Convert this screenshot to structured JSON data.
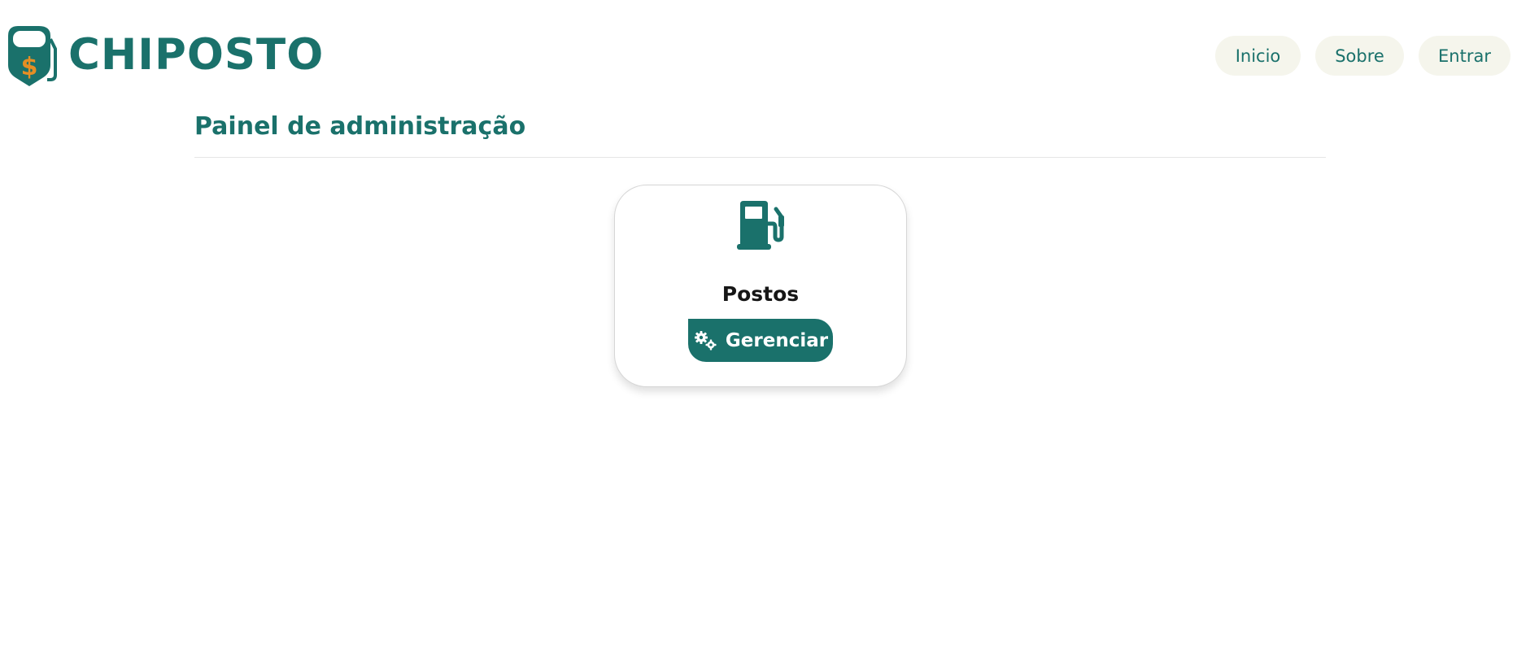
{
  "header": {
    "brand": "CHIPOSTO",
    "nav": [
      {
        "label": "Inicio"
      },
      {
        "label": "Sobre"
      },
      {
        "label": "Entrar"
      }
    ]
  },
  "main": {
    "title": "Painel de administração",
    "cards": [
      {
        "icon": "gas-pump-icon",
        "title": "Postos",
        "button_label": "Gerenciar",
        "button_icon": "cogs-icon"
      }
    ]
  },
  "colors": {
    "brand": "#1a716b",
    "accent": "#e58e24",
    "nav_bg": "#f5f5ec"
  }
}
